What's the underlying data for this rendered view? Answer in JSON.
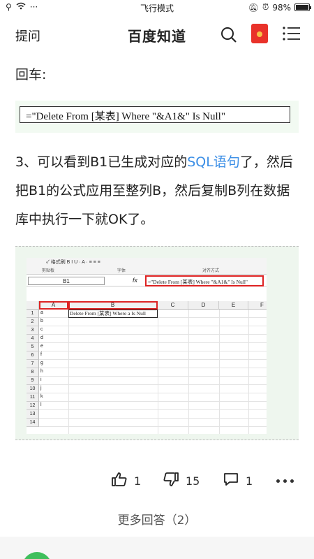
{
  "status_bar": {
    "center": "飞行模式",
    "battery": "98%",
    "battery_level": 0.98
  },
  "header": {
    "ask": "提问",
    "title": "百度知道",
    "search_icon": "search-icon",
    "red_packet_icon": "red-packet-icon",
    "menu_icon": "menu-icon"
  },
  "content": {
    "p1": "回车:",
    "code": "=\"Delete From [某表] Where \"&A1&\" Is Null\"",
    "para3_prefix": "3、可以看到B1已生成对应的",
    "para3_link": "SQL语句",
    "para3_suffix": "了，然后把B1的公式应用至整列B，然后复制B列在数据库中执行一下就OK了。"
  },
  "excel": {
    "ribbon_text": "✓ 格式刷   B  I  U  ·  A  ·   ≡ ≡ ≡",
    "groups": [
      "剪贴板",
      "字体",
      "对齐方式"
    ],
    "namebox": "B1",
    "fx": "fx",
    "formula": "=\"Delete From [某表] Where \"&A1&\" Is Null\"",
    "columns": [
      "A",
      "B",
      "C",
      "D",
      "E",
      "F"
    ],
    "rows": [
      "1",
      "2",
      "3",
      "4",
      "5",
      "6",
      "7",
      "8",
      "9",
      "10",
      "11",
      "12",
      "13",
      "14"
    ],
    "col_a_values": [
      "a",
      "b",
      "c",
      "d",
      "e",
      "f",
      "g",
      "h",
      "i",
      "j",
      "k",
      "l"
    ],
    "b1_value": "Delete From [某表] Where a Is Null"
  },
  "actions": {
    "like_count": "1",
    "dislike_count": "15",
    "comment_count": "1"
  },
  "more_answers": "更多回答（2）"
}
